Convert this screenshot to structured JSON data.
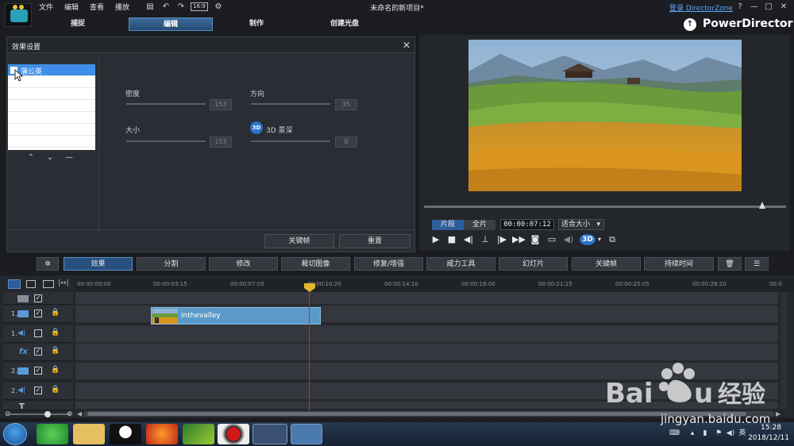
{
  "window": {
    "title": "未命名的新项目*",
    "login_link": "登录 DirectorZone",
    "menu": [
      "文件",
      "编辑",
      "查看",
      "播放"
    ],
    "ratio": "16:9",
    "controls": [
      "?",
      "—",
      "□",
      "✕"
    ]
  },
  "mode_tabs": [
    {
      "label": "捕捉",
      "active": false
    },
    {
      "label": "编辑",
      "active": true
    },
    {
      "label": "制作",
      "active": false
    },
    {
      "label": "创建光盘",
      "active": false
    }
  ],
  "brand": "PowerDirector",
  "effect_panel": {
    "title": "效果设置",
    "list_items": [
      "蒲公英"
    ],
    "params": {
      "density": {
        "label": "密度",
        "value": "153"
      },
      "direction": {
        "label": "方向",
        "value": "35"
      },
      "size": {
        "label": "大小",
        "value": "153"
      },
      "depth3d": {
        "label": "3D 景深",
        "value": "0",
        "icon_text": "3D"
      }
    },
    "keyframe_button": "关键帧",
    "reset_button": "重置"
  },
  "preview": {
    "clip_tab": "片段",
    "full_tab": "全片",
    "timecode": "00:00:07:12",
    "fit_label": "适合大小",
    "stereo_label": "3D"
  },
  "toolbar": {
    "buttons": [
      "效果",
      "分割",
      "修改",
      "裁切图像",
      "修复/增强",
      "威力工具",
      "幻灯片",
      "关键帧",
      "持续时间"
    ],
    "active_index": 0
  },
  "timeline": {
    "ruler": [
      "00:00:00:00",
      "00:00:03:15",
      "00:00:07:05",
      "00:00:10:20",
      "00:00:14:10",
      "00:00:18:00",
      "00:00:21:15",
      "00:00:25:05",
      "00:00:28:20",
      "00:0"
    ],
    "tracks": [
      {
        "num": "",
        "type": "master",
        "checked": true
      },
      {
        "num": "1.",
        "type": "video",
        "checked": true
      },
      {
        "num": "1.",
        "type": "audio",
        "checked": false
      },
      {
        "num": "",
        "type": "fx",
        "checked": true,
        "label": "fx"
      },
      {
        "num": "2.",
        "type": "video",
        "checked": true
      },
      {
        "num": "2.",
        "type": "audio",
        "checked": true
      },
      {
        "num": "",
        "type": "title",
        "checked": false,
        "label": "T"
      }
    ],
    "clip_label": "inthevalley"
  },
  "taskbar": {
    "time": "15:28",
    "date": "2018/12/11"
  },
  "watermark": {
    "text": "jingyan.baidu.com"
  }
}
